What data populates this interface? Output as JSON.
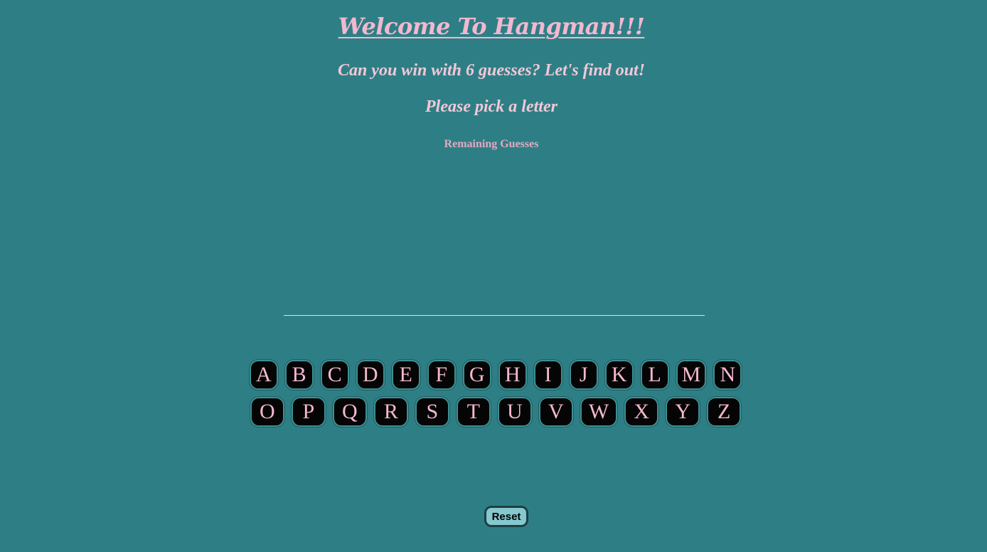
{
  "header": {
    "title": "Welcome To Hangman!!!",
    "subtitle": "Can you win with 6 guesses? Let's find out!",
    "prompt": "Please pick a letter",
    "remaining_label": "Remaining Guesses"
  },
  "keyboard": {
    "row1": [
      "A",
      "B",
      "C",
      "D",
      "E",
      "F",
      "G",
      "H",
      "I",
      "J",
      "K",
      "L",
      "M",
      "N"
    ],
    "row2": [
      "O",
      "P",
      "Q",
      "R",
      "S",
      "T",
      "U",
      "V",
      "W",
      "X",
      "Y",
      "Z"
    ]
  },
  "controls": {
    "reset_label": "Reset"
  },
  "colors": {
    "background": "#2e7f85",
    "accent_pink": "#f3b8cf",
    "key_bg": "#050505",
    "reset_bg": "#85c8cf"
  }
}
